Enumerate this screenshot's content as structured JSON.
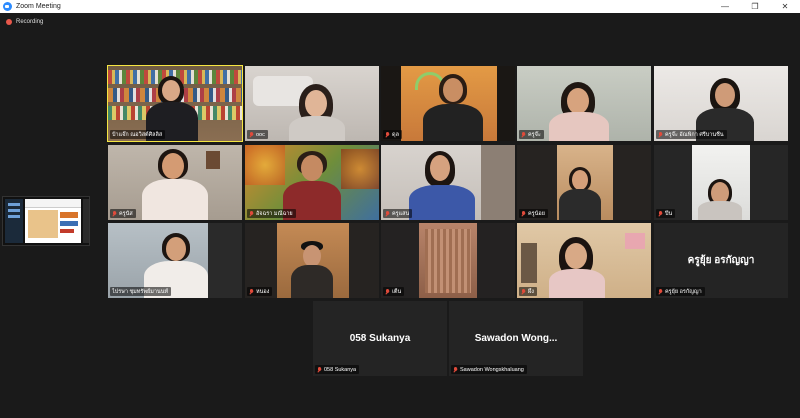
{
  "window": {
    "title": "Zoom Meeting",
    "controls": {
      "minimize": "—",
      "maximize": "❐",
      "close": "✕"
    }
  },
  "recording": {
    "label": "Recording"
  },
  "colors": {
    "active_speaker": "#f5e642",
    "muted_mic": "#e14b3b",
    "recording_dot": "#e8584b"
  },
  "participants": [
    {
      "name": "ป้าแจ๊ก ณอวิสต์ศิลลิส",
      "muted": false
    },
    {
      "name": "ooc",
      "muted": true
    },
    {
      "name": "ดุล",
      "muted": true
    },
    {
      "name": "ครูจ๊ะ",
      "muted": true
    },
    {
      "name": "ครูจ๊ะ อัณพิกา ศรีบานชื่น",
      "muted": true
    },
    {
      "name": "ครูนัส",
      "muted": true
    },
    {
      "name": "อัจฉรา มณีฉาย",
      "muted": true
    },
    {
      "name": "ครูแสน",
      "muted": true
    },
    {
      "name": "ครูน้อย",
      "muted": true
    },
    {
      "name": "ปีน",
      "muted": true
    },
    {
      "name": "ไปรษา ชุมทรัพย์มานนท์",
      "muted": true
    },
    {
      "name": "หนอง",
      "muted": true
    },
    {
      "name": "เติ้น",
      "muted": true
    },
    {
      "name": "ผึ้ง",
      "muted": true
    },
    {
      "name": "ครูยุ้ย อรกัญญา",
      "muted": true,
      "display": "ครูยุ้ย อรกัญญา"
    },
    {
      "name": "058 Sukanya",
      "muted": true,
      "display": "058 Sukanya"
    },
    {
      "name": "Sawadon Wongskhaluang",
      "muted": true,
      "display": "Sawadon Wong..."
    }
  ]
}
